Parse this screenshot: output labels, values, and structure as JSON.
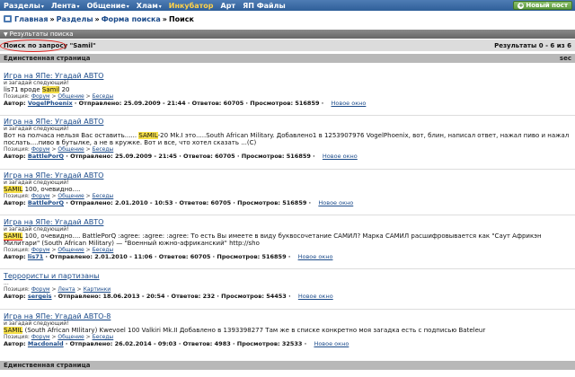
{
  "nav": {
    "items": [
      {
        "label": "Разделы",
        "caret": true
      },
      {
        "label": "Лента",
        "caret": true
      },
      {
        "label": "Общение",
        "caret": true
      },
      {
        "label": "Хлам",
        "caret": true
      },
      {
        "label": "Инкубатор",
        "caret": false,
        "active": true
      },
      {
        "label": "Арт",
        "caret": false
      },
      {
        "label": "ЯП Файлы",
        "caret": false
      }
    ],
    "new_post": "Новый пост"
  },
  "breadcrumb": {
    "home": "Главная",
    "sections": "Разделы",
    "search_form": "Форма поиска",
    "current": "Поиск",
    "sep": "»"
  },
  "results_header": "Результаты поиска",
  "query_label": "Поиск по запросу \"Samil\"",
  "results_count": "Результаты 0 - 6 из 6",
  "single_page": "Единственная страница",
  "sec": "sec",
  "results": [
    {
      "title": "Игра на ЯПе: Угадай АВТО",
      "sub": "и загадай следующий!",
      "snippet_pre": "lis71 вроде ",
      "snippet_hl": "Samil",
      "snippet_post": " 20",
      "pos": [
        "Форум",
        "Общение",
        "Беседы"
      ],
      "author": "VogelPhoenix",
      "sent": "25.09.2009 - 21:44",
      "replies": "60705",
      "views": "516859",
      "new_window": "Новое окно"
    },
    {
      "title": "Игра на ЯПе: Угадай АВТО",
      "sub": "и загадай следующий!",
      "snippet_pre": "Вот на полчаса нельзя Вас оставить...... ",
      "snippet_hl": "SAMIL",
      "snippet_post": "-20 Mk.I это.....South African Military. Добавлено1 в 1253907976 VogelPhoenix, вот, блин, написал ответ, нажал пиво и нажал послать....пиво в бутылке, а не в кружке. Вот и все, что хотел сказать ...(С)",
      "pos": [
        "Форум",
        "Общение",
        "Беседы"
      ],
      "author": "BattlePorQ",
      "sent": "25.09.2009 - 21:45",
      "replies": "60705",
      "views": "516859",
      "new_window": "Новое окно"
    },
    {
      "title": "Игра на ЯПе: Угадай АВТО",
      "sub": "и загадай следующий!",
      "snippet_pre": "",
      "snippet_hl": "SAMIL",
      "snippet_post": " 100, очевидно....",
      "pos": [
        "Форум",
        "Общение",
        "Беседы"
      ],
      "author": "BattlePorQ",
      "sent": "2.01.2010 - 10:53",
      "replies": "60705",
      "views": "516859",
      "new_window": "Новое окно"
    },
    {
      "title": "Игра на ЯПе: Угадай АВТО",
      "sub": "и загадай следующий!",
      "snippet_pre": "",
      "snippet_hl": "SAMIL",
      "snippet_post": " 100, очевидно.... BattlePorQ :agree: :agree: :agree: То есть Вы имеете в виду буквосочетание САМИЛ? Марка САМИЛ расшифровывается как \"Саут Африкэн Милитари\" (South African Military) — \"Военный южно-африканский\" http://sho",
      "pos": [
        "Форум",
        "Общение",
        "Беседы"
      ],
      "author": "lis71",
      "sent": "2.01.2010 - 11:06",
      "replies": "60705",
      "views": "516859",
      "new_window": "Новое окно"
    },
    {
      "title": "Террористы и партизаны",
      "sub": "...",
      "snippet_pre": "",
      "snippet_hl": "",
      "snippet_post": "",
      "pos": [
        "Форум",
        "Лента",
        "Картинки"
      ],
      "author": "sergeis",
      "sent": "18.06.2013 - 20:54",
      "replies": "232",
      "views": "54453",
      "new_window": "Новое окно"
    },
    {
      "title": "Игра на ЯПе: Угадай АВТО-8",
      "sub": "и загадай следующий!",
      "snippet_pre": "",
      "snippet_hl": "SAMIL",
      "snippet_post": " (South African MIlitary) Kwevoel 100 Valkiri Mk.II Добавлено в 1393398277 Там же в списке конкретно моя загадка есть с подписью Bateleur",
      "pos": [
        "Форум",
        "Общение",
        "Беседы"
      ],
      "author": "Macdonald",
      "sent": "26.02.2014 - 09:03",
      "replies": "4983",
      "views": "32533",
      "new_window": "Новое окно"
    }
  ],
  "labels": {
    "pos": "Позиция:",
    "author": "Автор:",
    "sent": "Отправлено:",
    "replies": "Ответов:",
    "views": "Просмотров:",
    "gt": ">"
  }
}
